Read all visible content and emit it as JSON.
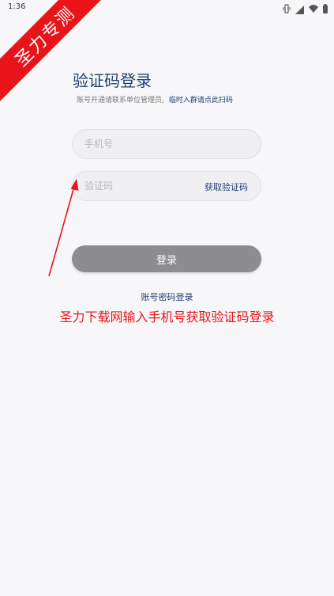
{
  "status_bar": {
    "time": "1:36"
  },
  "watermark": {
    "text": "圣力专测"
  },
  "login": {
    "title": "验证码登录",
    "subtitle_text": "账号开通请联系单位管理员,",
    "subtitle_link": "临时入群请点此扫码",
    "phone_placeholder": "手机号",
    "code_placeholder": "验证码",
    "get_code_label": "获取验证码",
    "login_button_label": "登录",
    "password_login_label": "账号密码登录"
  },
  "annotation": {
    "text": "圣力下载网输入手机号获取验证码登录"
  },
  "colors": {
    "primary_text": "#1f3f72",
    "accent_red": "#e8141a",
    "button_gray": "#8d8d90"
  },
  "icons": [
    "vibrate-icon",
    "signal-icon",
    "wifi-icon",
    "battery-icon"
  ]
}
